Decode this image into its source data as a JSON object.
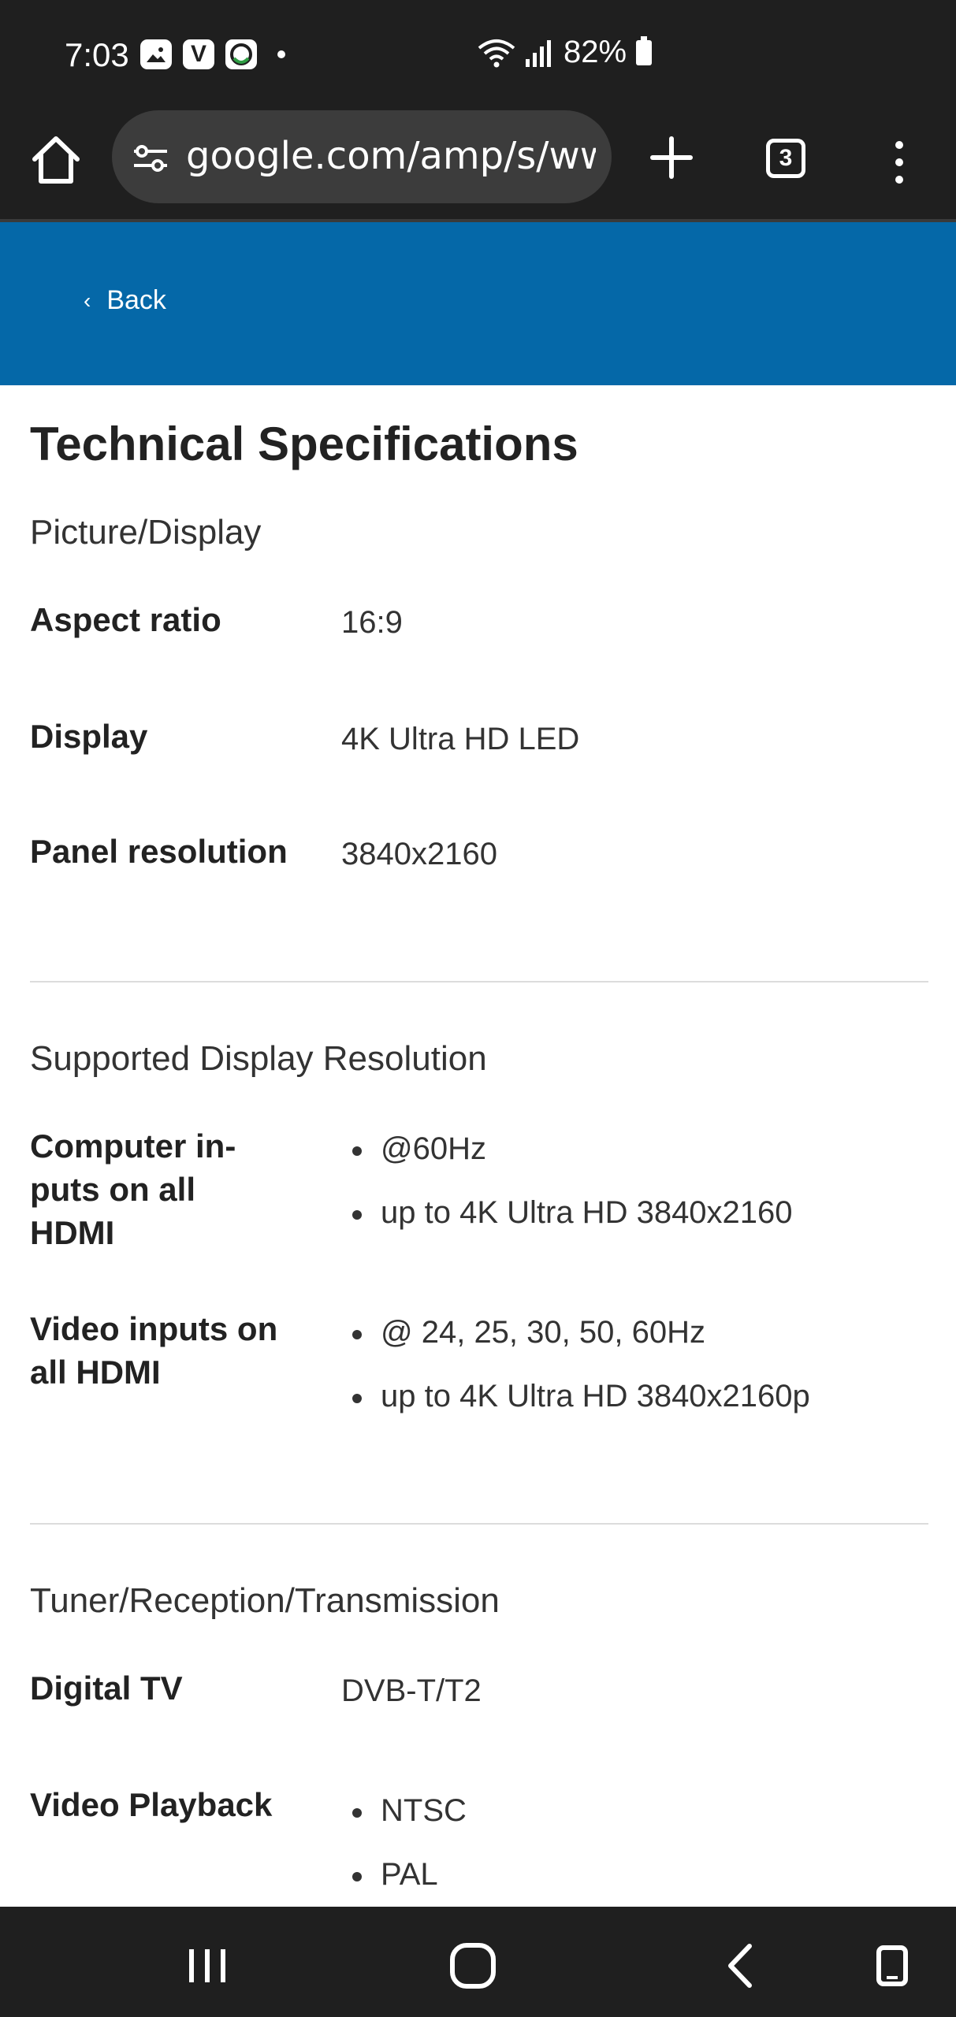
{
  "status_bar": {
    "time": "7:03",
    "app_icons": [
      "gallery-icon",
      "v-app-icon",
      "e-app-icon"
    ],
    "battery": "82%"
  },
  "browser": {
    "url": "google.com/amp/s/www",
    "tab_count": "3"
  },
  "header": {
    "back_label": "Back",
    "color": "#0568a8"
  },
  "page": {
    "title": "Technical Specifications",
    "sections": [
      {
        "title": "Picture/Display",
        "rows": [
          {
            "label": "Aspect ratio",
            "value": "16:9"
          },
          {
            "label": "Display",
            "value": "4K Ultra HD LED"
          },
          {
            "label": "Panel resolution",
            "value": "3840x2160"
          }
        ]
      },
      {
        "title": "Supported Display Resolution",
        "rows": [
          {
            "label": "Computer in-puts on all HDMI",
            "label_lines": [
              "Computer in-",
              "puts on all",
              "HDMI"
            ],
            "values": [
              "@60Hz",
              "up to 4K Ultra HD 3840x2160"
            ]
          },
          {
            "label": "Video inputs on all HDMI",
            "label_lines": [
              "Video inputs on",
              "all HDMI"
            ],
            "values": [
              "@ 24, 25, 30, 50, 60Hz",
              "up to 4K Ultra HD 3840x2160p"
            ]
          }
        ]
      },
      {
        "title": "Tuner/Reception/Transmission",
        "rows": [
          {
            "label": "Digital TV",
            "value": "DVB-T/T2"
          },
          {
            "label": "Video Playback",
            "values": [
              "NTSC",
              "PAL"
            ]
          }
        ]
      }
    ]
  }
}
